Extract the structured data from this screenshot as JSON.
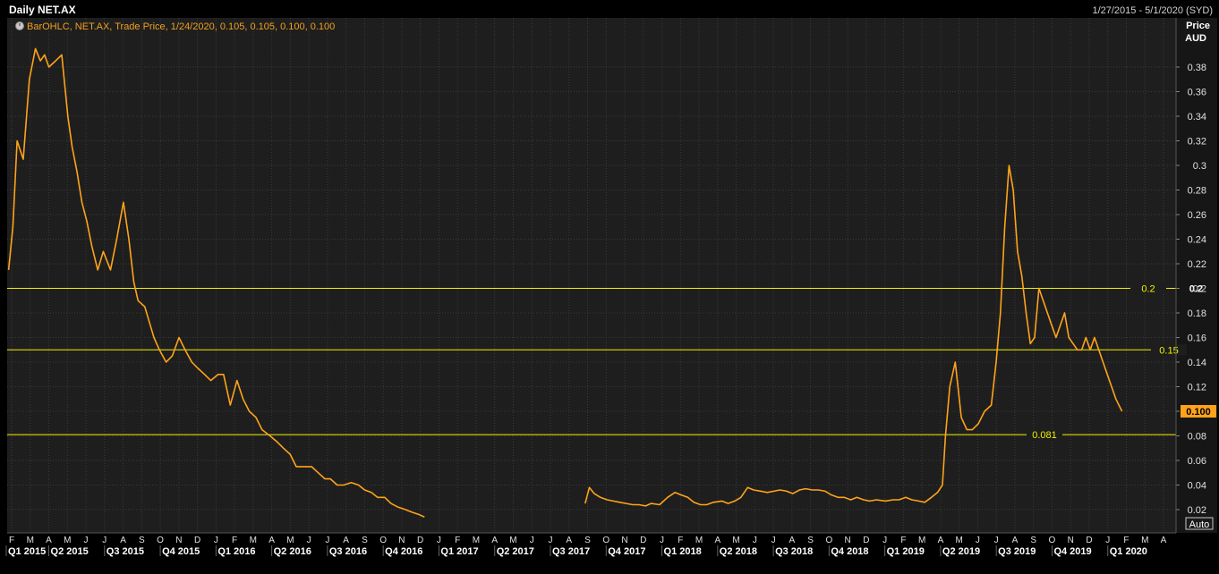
{
  "header": {
    "title": "Daily NET.AX",
    "date_range": "1/27/2015 - 5/1/2020 (SYD)"
  },
  "legend": {
    "text": "BarOHLC, NET.AX, Trade Price,  1/24/2020, 0.105, 0.105, 0.100, 0.100"
  },
  "y_axis": {
    "title_line1": "Price",
    "title_line2": "AUD",
    "tick_labels": [
      "0.38",
      "0.36",
      "0.34",
      "0.32",
      "0.3",
      "0.28",
      "0.26",
      "0.24",
      "0.22",
      "0.2",
      "0.18",
      "0.16",
      "0.14",
      "0.12",
      "0.1",
      "0.08",
      "0.06",
      "0.04",
      "0.02"
    ]
  },
  "x_axis": {
    "month_letters": [
      "F",
      "M",
      "A",
      "M",
      "J",
      "J",
      "A",
      "S",
      "O",
      "N",
      "D",
      "J",
      "F",
      "M",
      "A",
      "M",
      "J",
      "J",
      "A",
      "S",
      "O",
      "N",
      "D",
      "J",
      "F",
      "M",
      "A",
      "M",
      "J",
      "J",
      "A",
      "S",
      "O",
      "N",
      "D",
      "J",
      "F",
      "M",
      "A",
      "M",
      "J",
      "J",
      "A",
      "S",
      "O",
      "N",
      "D",
      "J",
      "F",
      "M",
      "A",
      "M",
      "J",
      "J",
      "A",
      "S",
      "O",
      "N",
      "D",
      "J",
      "F",
      "M",
      "A"
    ],
    "quarter_labels": [
      "Q1 2015",
      "Q2 2015",
      "Q3 2015",
      "Q4 2015",
      "Q1 2016",
      "Q2 2016",
      "Q3 2016",
      "Q4 2016",
      "Q1 2017",
      "Q2 2017",
      "Q3 2017",
      "Q4 2017",
      "Q1 2018",
      "Q2 2018",
      "Q3 2018",
      "Q4 2018",
      "Q1 2019",
      "Q2 2019",
      "Q3 2019",
      "Q4 2019",
      "Q1 2020"
    ]
  },
  "auto_button": "Auto",
  "colors": {
    "background": "#000000",
    "plot_background": "#1e1e1e",
    "grid": "#3a3a3a",
    "price": "#ffa31a",
    "level_line": "#f0f000",
    "legend_text": "#f0a020",
    "last_price_bg": "#ffa31a"
  },
  "chart_data": {
    "type": "line",
    "title": "Daily NET.AX",
    "ylabel": "Price AUD",
    "xlim": [
      "2015-01-27",
      "2020-05-01"
    ],
    "ylim": [
      0.0,
      0.4
    ],
    "grid": true,
    "last_price": {
      "label": "0.100",
      "value": 0.1
    },
    "horizontal_lines": [
      {
        "value": 0.2,
        "label": "0.2"
      },
      {
        "value": 0.15,
        "label": "0.15"
      },
      {
        "value": 0.081,
        "label": "0.081"
      }
    ],
    "series": [
      {
        "x": [
          "2015-01-27",
          "2015-02-03",
          "2015-02-10",
          "2015-02-20",
          "2015-03-02",
          "2015-03-12",
          "2015-03-20",
          "2015-03-27",
          "2015-04-03",
          "2015-04-14",
          "2015-04-24",
          "2015-05-04",
          "2015-05-11",
          "2015-05-19",
          "2015-05-27",
          "2015-06-04",
          "2015-06-12",
          "2015-06-22",
          "2015-07-01",
          "2015-07-13",
          "2015-07-23",
          "2015-08-03",
          "2015-08-12",
          "2015-08-20",
          "2015-08-27",
          "2015-09-07",
          "2015-09-16",
          "2015-09-22",
          "2015-10-01",
          "2015-10-12",
          "2015-10-22",
          "2015-11-02",
          "2015-11-12",
          "2015-11-23",
          "2015-12-03",
          "2015-12-14",
          "2015-12-24",
          "2016-01-05",
          "2016-01-14",
          "2016-01-25",
          "2016-02-05",
          "2016-02-15",
          "2016-02-25",
          "2016-03-07",
          "2016-03-17",
          "2016-03-30",
          "2016-04-11",
          "2016-04-21",
          "2016-05-02",
          "2016-05-12",
          "2016-05-24",
          "2016-06-06",
          "2016-06-17",
          "2016-06-28",
          "2016-07-07",
          "2016-07-18",
          "2016-07-29",
          "2016-08-10",
          "2016-08-22",
          "2016-09-01",
          "2016-09-12",
          "2016-09-22",
          "2016-10-04",
          "2016-10-14",
          "2016-10-26",
          "2016-11-07",
          "2016-11-17",
          "2016-11-29",
          "2016-12-08",
          "2017-08-28",
          "2017-09-04",
          "2017-09-12",
          "2017-09-22",
          "2017-10-03",
          "2017-10-13",
          "2017-10-24",
          "2017-11-03",
          "2017-11-14",
          "2017-11-24",
          "2017-12-05",
          "2017-12-14",
          "2017-12-28",
          "2018-01-10",
          "2018-01-22",
          "2018-02-01",
          "2018-02-12",
          "2018-02-22",
          "2018-03-05",
          "2018-03-15",
          "2018-03-26",
          "2018-04-09",
          "2018-04-19",
          "2018-04-30",
          "2018-05-10",
          "2018-05-21",
          "2018-05-31",
          "2018-06-12",
          "2018-06-22",
          "2018-07-03",
          "2018-07-13",
          "2018-07-24",
          "2018-08-03",
          "2018-08-14",
          "2018-08-24",
          "2018-09-04",
          "2018-09-14",
          "2018-09-25",
          "2018-10-05",
          "2018-10-16",
          "2018-10-26",
          "2018-11-06",
          "2018-11-16",
          "2018-11-27",
          "2018-12-07",
          "2018-12-18",
          "2019-01-02",
          "2019-01-14",
          "2019-01-24",
          "2019-02-04",
          "2019-02-14",
          "2019-02-25",
          "2019-03-07",
          "2019-03-18",
          "2019-03-28",
          "2019-04-05",
          "2019-04-10",
          "2019-04-17",
          "2019-04-26",
          "2019-05-06",
          "2019-05-15",
          "2019-05-24",
          "2019-06-03",
          "2019-06-13",
          "2019-06-24",
          "2019-07-02",
          "2019-07-09",
          "2019-07-16",
          "2019-07-23",
          "2019-07-30",
          "2019-08-06",
          "2019-08-13",
          "2019-08-20",
          "2019-08-27",
          "2019-09-03",
          "2019-09-10",
          "2019-09-17",
          "2019-09-24",
          "2019-10-01",
          "2019-10-08",
          "2019-10-15",
          "2019-10-22",
          "2019-10-29",
          "2019-11-05",
          "2019-11-12",
          "2019-11-19",
          "2019-11-26",
          "2019-12-03",
          "2019-12-10",
          "2019-12-17",
          "2019-12-24",
          "2019-12-31",
          "2020-01-07",
          "2020-01-14",
          "2020-01-24"
        ],
        "values": [
          0.215,
          0.25,
          0.32,
          0.305,
          0.37,
          0.395,
          0.385,
          0.39,
          0.38,
          0.385,
          0.39,
          0.34,
          0.315,
          0.295,
          0.27,
          0.255,
          0.235,
          0.215,
          0.23,
          0.215,
          0.24,
          0.27,
          0.24,
          0.205,
          0.19,
          0.185,
          0.17,
          0.16,
          0.15,
          0.14,
          0.145,
          0.16,
          0.15,
          0.14,
          0.135,
          0.13,
          0.125,
          0.13,
          0.13,
          0.105,
          0.125,
          0.11,
          0.1,
          0.095,
          0.085,
          0.08,
          0.075,
          0.07,
          0.065,
          0.055,
          0.055,
          0.055,
          0.05,
          0.045,
          0.045,
          0.04,
          0.04,
          0.042,
          0.04,
          0.036,
          0.034,
          0.03,
          0.03,
          0.025,
          0.022,
          0.02,
          0.018,
          0.016,
          0.014,
          0.025,
          0.038,
          0.033,
          0.03,
          0.028,
          0.027,
          0.026,
          0.025,
          0.024,
          0.024,
          0.023,
          0.025,
          0.024,
          0.03,
          0.034,
          0.032,
          0.03,
          0.026,
          0.024,
          0.024,
          0.026,
          0.027,
          0.025,
          0.027,
          0.03,
          0.038,
          0.036,
          0.035,
          0.034,
          0.035,
          0.036,
          0.035,
          0.033,
          0.036,
          0.037,
          0.036,
          0.036,
          0.035,
          0.032,
          0.03,
          0.03,
          0.028,
          0.03,
          0.028,
          0.027,
          0.028,
          0.027,
          0.028,
          0.028,
          0.03,
          0.028,
          0.027,
          0.026,
          0.03,
          0.034,
          0.04,
          0.08,
          0.12,
          0.14,
          0.095,
          0.085,
          0.085,
          0.09,
          0.1,
          0.105,
          0.14,
          0.18,
          0.25,
          0.3,
          0.28,
          0.23,
          0.21,
          0.18,
          0.155,
          0.16,
          0.2,
          0.19,
          0.18,
          0.17,
          0.16,
          0.17,
          0.18,
          0.16,
          0.155,
          0.15,
          0.15,
          0.16,
          0.15,
          0.16,
          0.15,
          0.14,
          0.13,
          0.12,
          0.11,
          0.1
        ]
      }
    ]
  }
}
